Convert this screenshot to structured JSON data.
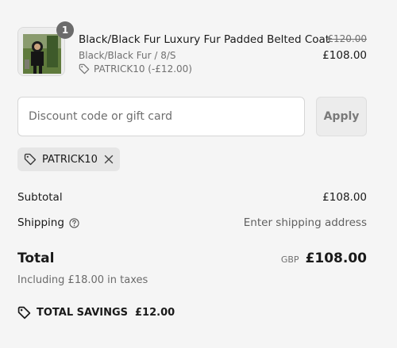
{
  "product": {
    "quantity": "1",
    "title": "Black/Black Fur Luxury Fur Padded Belted Coat",
    "variant": "Black/Black Fur / 8/S",
    "discount_line": "PATRICK10 (-£12.00)",
    "original_price": "£120.00",
    "price": "£108.00",
    "image_icon": "product-photo-coat"
  },
  "discount": {
    "placeholder": "Discount code or gift card",
    "value": "",
    "apply_label": "Apply"
  },
  "applied_code": {
    "code": "PATRICK10"
  },
  "summary": {
    "subtotal_label": "Subtotal",
    "subtotal_value": "£108.00",
    "shipping_label": "Shipping",
    "shipping_value": "Enter shipping address",
    "total_label": "Total",
    "currency": "GBP",
    "total_value": "£108.00",
    "taxes_note": "Including £18.00 in taxes"
  },
  "savings": {
    "label": "TOTAL SAVINGS",
    "amount": "£12.00"
  }
}
